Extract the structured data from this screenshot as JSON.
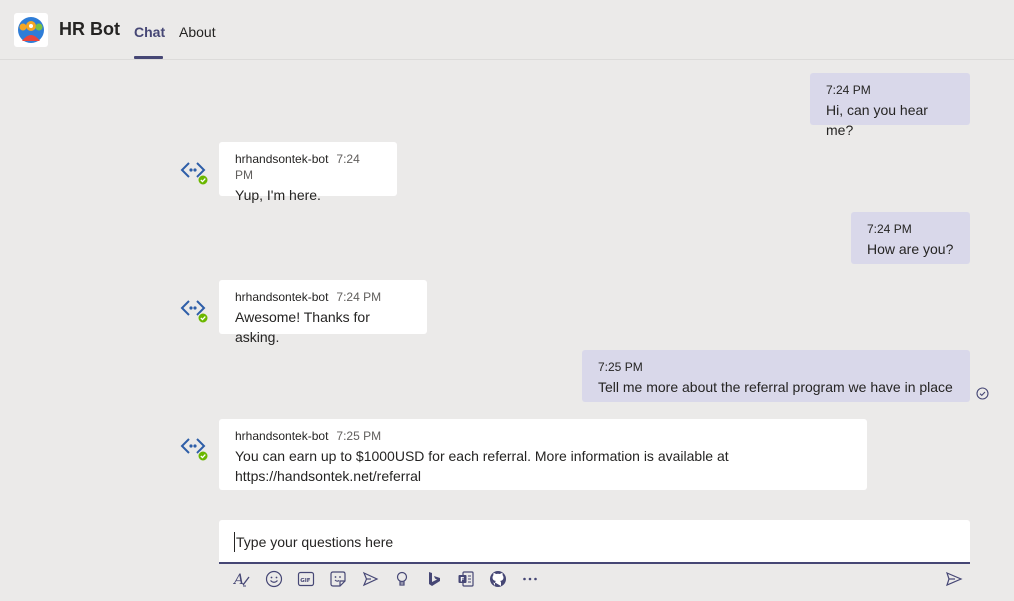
{
  "app": {
    "title": "HR Bot",
    "tabs": [
      {
        "label": "Chat",
        "active": true
      },
      {
        "label": "About",
        "active": false
      }
    ]
  },
  "colors": {
    "accent": "#464775",
    "user_bubble": "#d9d8ea",
    "bot_bubble": "#ffffff",
    "background": "#ebeae9",
    "status_green": "#6bb700",
    "bot_icon": "#2e5ea8"
  },
  "messages": [
    {
      "from": "user",
      "time": "7:24 PM",
      "text": "Hi, can you hear me?"
    },
    {
      "from": "bot",
      "sender": "hrhandsontek-bot",
      "time": "7:24 PM",
      "text": "Yup, I'm here."
    },
    {
      "from": "user",
      "time": "7:24 PM",
      "text": "How are you?"
    },
    {
      "from": "bot",
      "sender": "hrhandsontek-bot",
      "time": "7:24 PM",
      "text": "Awesome! Thanks for asking."
    },
    {
      "from": "user",
      "time": "7:25 PM",
      "text": "Tell me more about the referral program we have in place"
    },
    {
      "from": "bot",
      "sender": "hrhandsontek-bot",
      "time": "7:25 PM",
      "text": "You can earn up to $1000USD for each referral. More information is available at https://handsontek.net/referral"
    }
  ],
  "compose": {
    "placeholder": "Type your questions here",
    "value": ""
  },
  "toolbar": {
    "icons": [
      "format-icon",
      "emoji-icon",
      "gif-icon",
      "sticker-icon",
      "meet-icon",
      "praise-icon",
      "bing-icon",
      "forms-icon",
      "github-icon",
      "more-icon"
    ],
    "send": "send-icon"
  }
}
